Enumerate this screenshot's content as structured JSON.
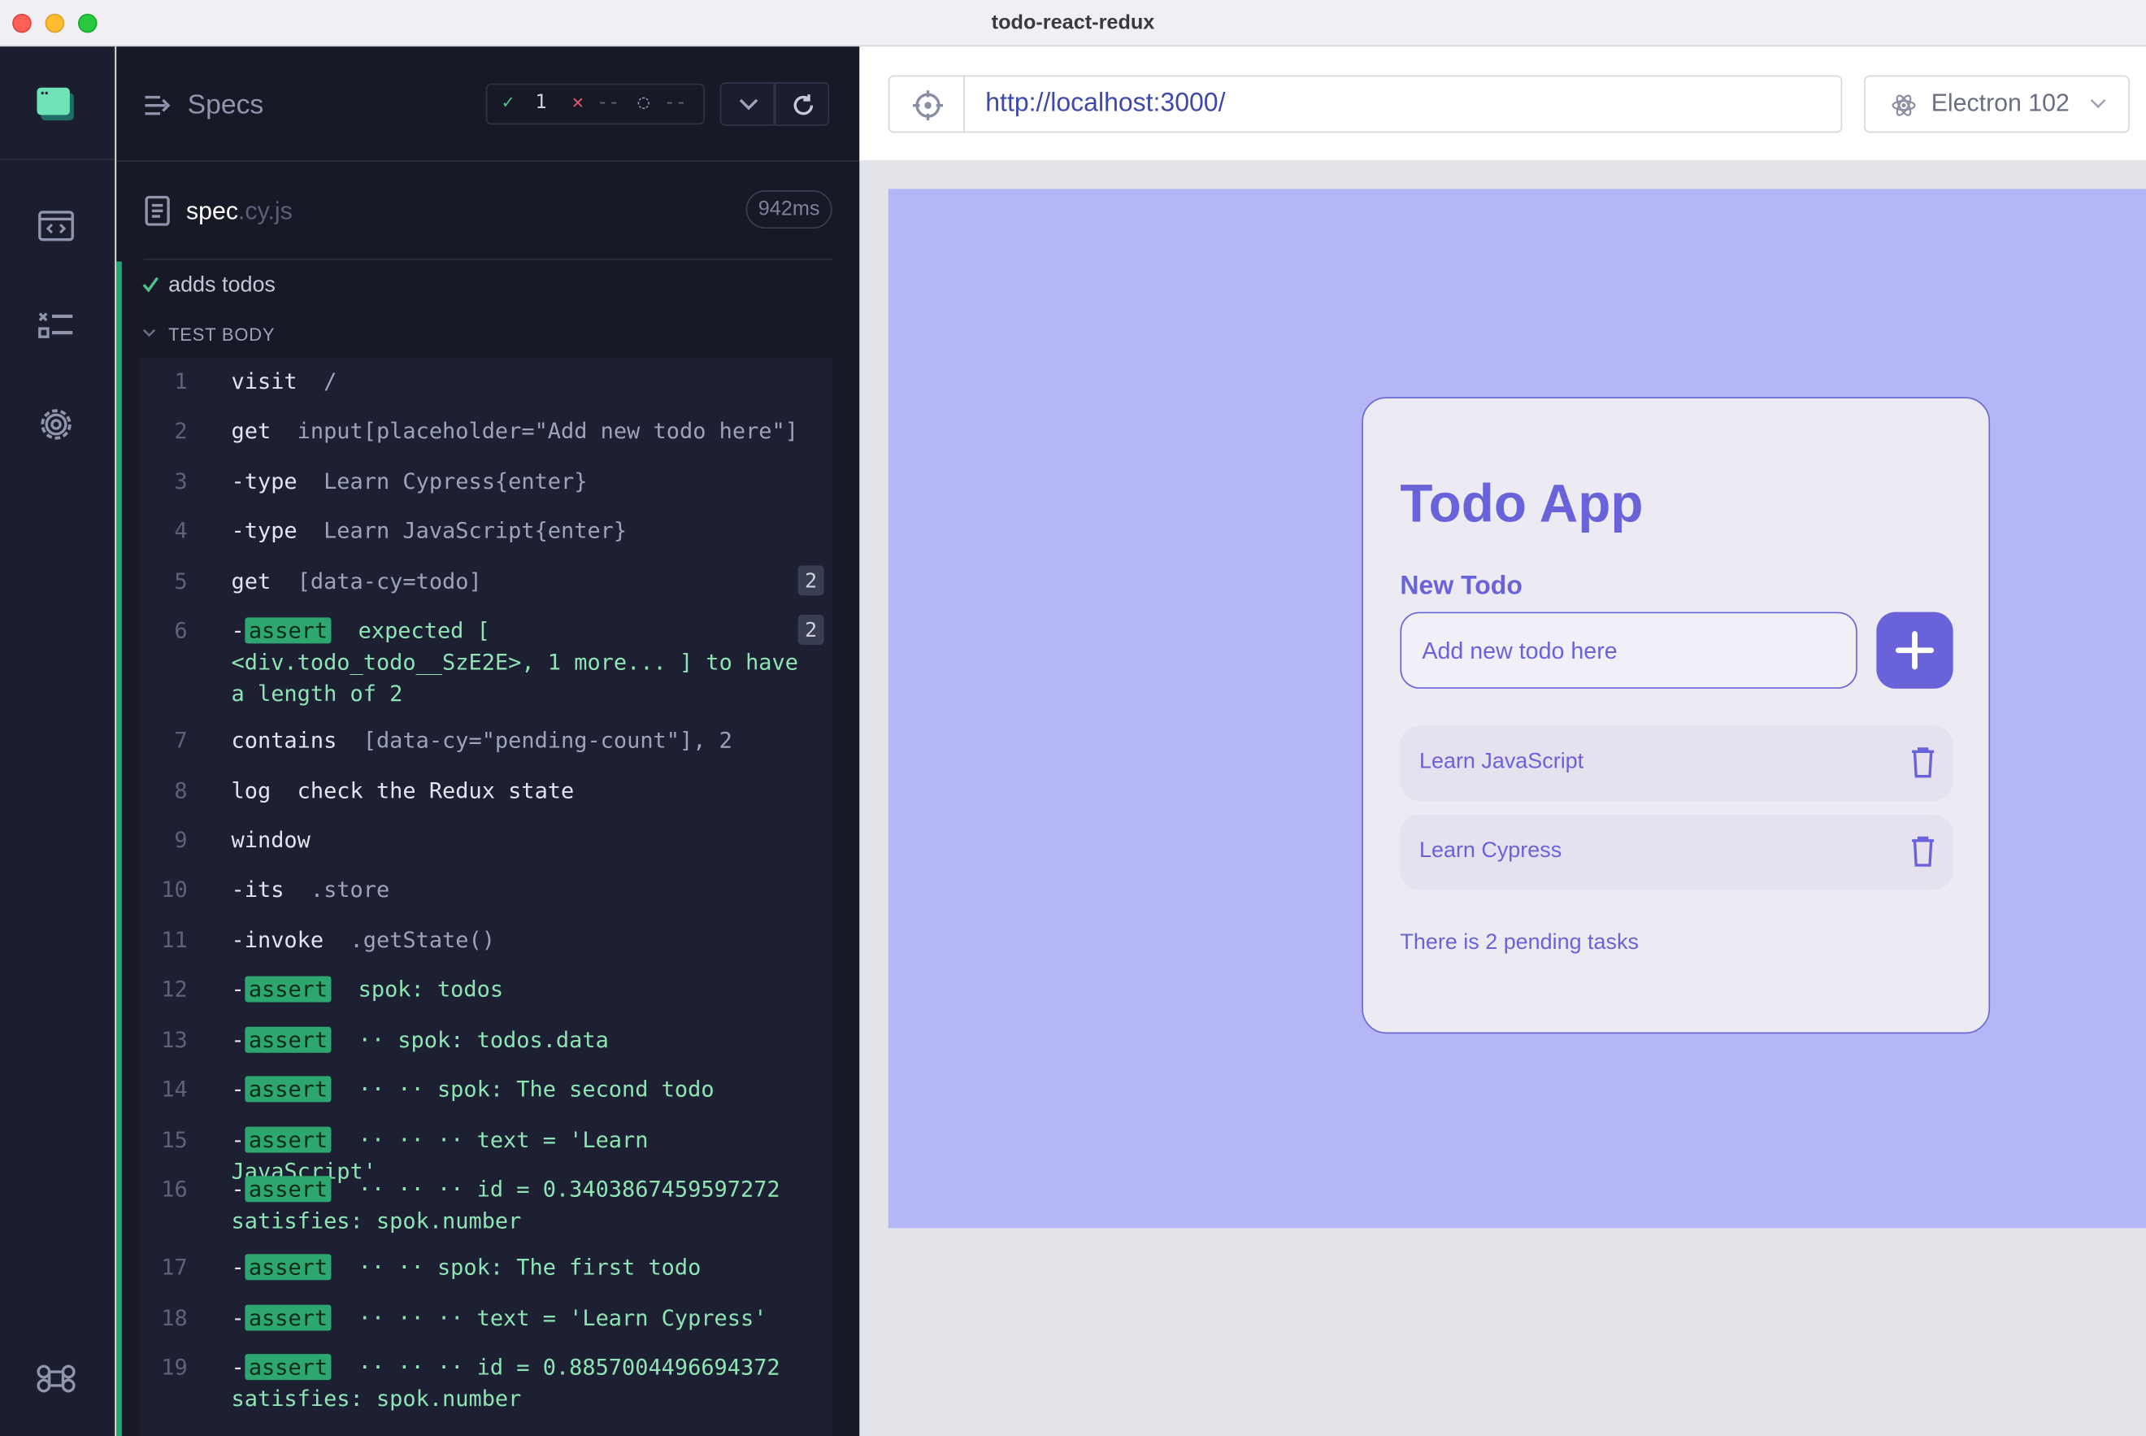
{
  "window": {
    "title": "todo-react-redux"
  },
  "nav": {
    "items": [
      "specs-nav",
      "runs-nav",
      "settings-nav",
      "keyboard-shortcuts"
    ]
  },
  "reporter": {
    "header_title": "Specs",
    "stats": {
      "passed": "1",
      "failed": "--",
      "pending": "--"
    },
    "spec": {
      "name": "spec",
      "ext": ".cy.js",
      "duration": "942ms"
    },
    "test_title": "adds todos",
    "test_body_label": "TEST BODY",
    "commands": [
      {
        "n": "1",
        "name": "visit",
        "msg": "/"
      },
      {
        "n": "2",
        "name": "get",
        "msg": "input[placeholder=\"Add new todo here\"]"
      },
      {
        "n": "3",
        "name": "-type",
        "msg": "Learn Cypress{enter}"
      },
      {
        "n": "4",
        "name": "-type",
        "msg": "Learn JavaScript{enter}"
      },
      {
        "n": "5",
        "name": "get",
        "msg": "[data-cy=todo]",
        "count": "2"
      },
      {
        "n": "6",
        "assert": true,
        "msg": "expected [ <div.todo_todo__SzE2E>, 1 more... ] to have a length of 2",
        "count": "2"
      },
      {
        "n": "7",
        "name": "contains",
        "msg": "[data-cy=\"pending-count\"], 2"
      },
      {
        "n": "8",
        "name": "log",
        "msg": "check the Redux state",
        "bright": true
      },
      {
        "n": "9",
        "name": "window",
        "msg": ""
      },
      {
        "n": "10",
        "name": "-its",
        "msg": ".store"
      },
      {
        "n": "11",
        "name": "-invoke",
        "msg": ".getState()"
      },
      {
        "n": "12",
        "assert": true,
        "msg": "spok: todos"
      },
      {
        "n": "13",
        "assert": true,
        "msg": "·· spok: todos.data"
      },
      {
        "n": "14",
        "assert": true,
        "msg": "·· ·· spok: The second todo"
      },
      {
        "n": "15",
        "assert": true,
        "msg": "·· ·· ·· text = 'Learn JavaScript'"
      },
      {
        "n": "16",
        "assert": true,
        "msg": "·· ·· ·· id = 0.3403867459597272 satisfies: spok.number"
      },
      {
        "n": "17",
        "assert": true,
        "msg": "·· ·· spok: The first todo"
      },
      {
        "n": "18",
        "assert": true,
        "msg": "·· ·· ·· text = 'Learn Cypress'"
      },
      {
        "n": "19",
        "assert": true,
        "msg": "·· ·· ·· id = 0.8857004496694372 satisfies: spok.number"
      }
    ]
  },
  "assert_label": "assert",
  "browser": {
    "url": "http://localhost:3000/",
    "browser_label": "Electron 102"
  },
  "app": {
    "title": "Todo App",
    "new_label": "New Todo",
    "input_placeholder": "Add new todo here",
    "todos": [
      "Learn JavaScript",
      "Learn Cypress"
    ],
    "pending_text": "There is 2 pending tasks"
  }
}
